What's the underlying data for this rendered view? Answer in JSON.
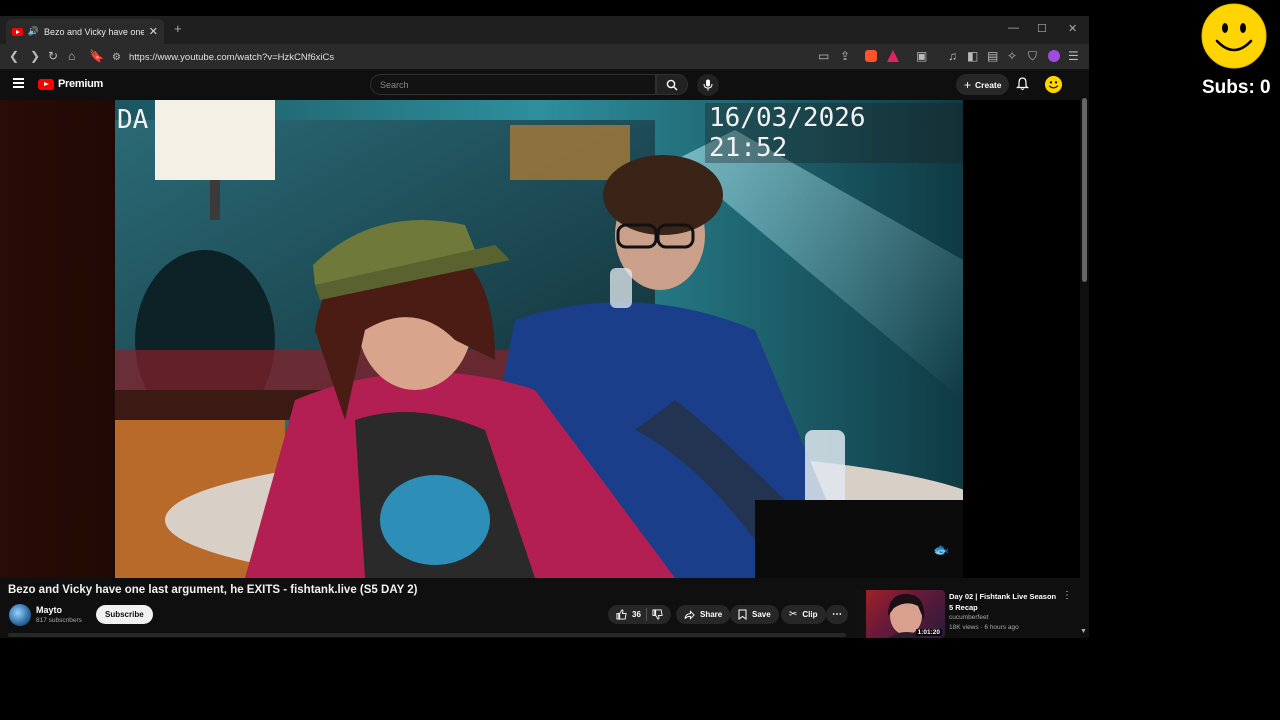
{
  "browser": {
    "tab_title": "Bezo and Vicky have one last argument, he EXITS - fishtank.live (S5 DAY 2)",
    "tab_close": "✕",
    "new_tab": "+",
    "url": "https://www.youtube.com/watch?v=HzkCNf6xiCs"
  },
  "youtube": {
    "logo_text": "Premium",
    "search_placeholder": "Search",
    "create_label": "Create"
  },
  "video": {
    "timestamp": "16/03/2026 21:52",
    "corner_text": "DA",
    "title": "Bezo and Vicky have one last argument, he EXITS - fishtank.live (S5 DAY 2)"
  },
  "channel": {
    "name": "Mayto",
    "subscribers": "817 subscribers",
    "subscribe_label": "Subscribe"
  },
  "actions": {
    "likes": "36",
    "share": "Share",
    "save": "Save",
    "clip": "Clip"
  },
  "recommendation": {
    "title": "Day 02 | Fishtank Live Season 5 Recap",
    "channel": "cucumberfeet",
    "meta": "18K views · 6 hours ago",
    "duration": "1:01:20"
  },
  "overlay": {
    "subs_text": "Subs: 0"
  },
  "colors": {
    "youtube_red": "#ff0000",
    "smiley_yellow": "#ffd400",
    "background": "#0f0f0f"
  }
}
